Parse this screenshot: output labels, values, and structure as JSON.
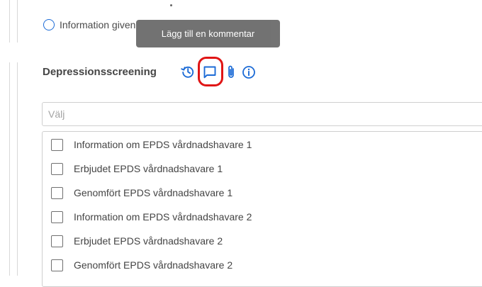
{
  "consent_field": {
    "option_label": "Information given"
  },
  "tooltip": {
    "text": "Lägg till en kommentar"
  },
  "depression_field": {
    "title": "Depressionsscreening",
    "icons": [
      "history-icon",
      "comment-icon",
      "paperclip-icon",
      "info-icon"
    ],
    "select_placeholder": "Välj",
    "options": [
      {
        "label": "Information om EPDS vårdnadshavare 1",
        "checked": false
      },
      {
        "label": "Erbjudet EPDS vårdnadshavare 1",
        "checked": false
      },
      {
        "label": "Genomfört EPDS vårdnadshavare 1",
        "checked": false
      },
      {
        "label": "Information om EPDS vårdnadshavare 2",
        "checked": false
      },
      {
        "label": "Erbjudet EPDS vårdnadshavare 2",
        "checked": false
      },
      {
        "label": "Genomfört EPDS vårdnadshavare 2",
        "checked": false
      }
    ]
  },
  "colors": {
    "accent": "#1c6bd6",
    "highlight": "#e01515",
    "tooltip_bg": "#6d6d6d"
  }
}
